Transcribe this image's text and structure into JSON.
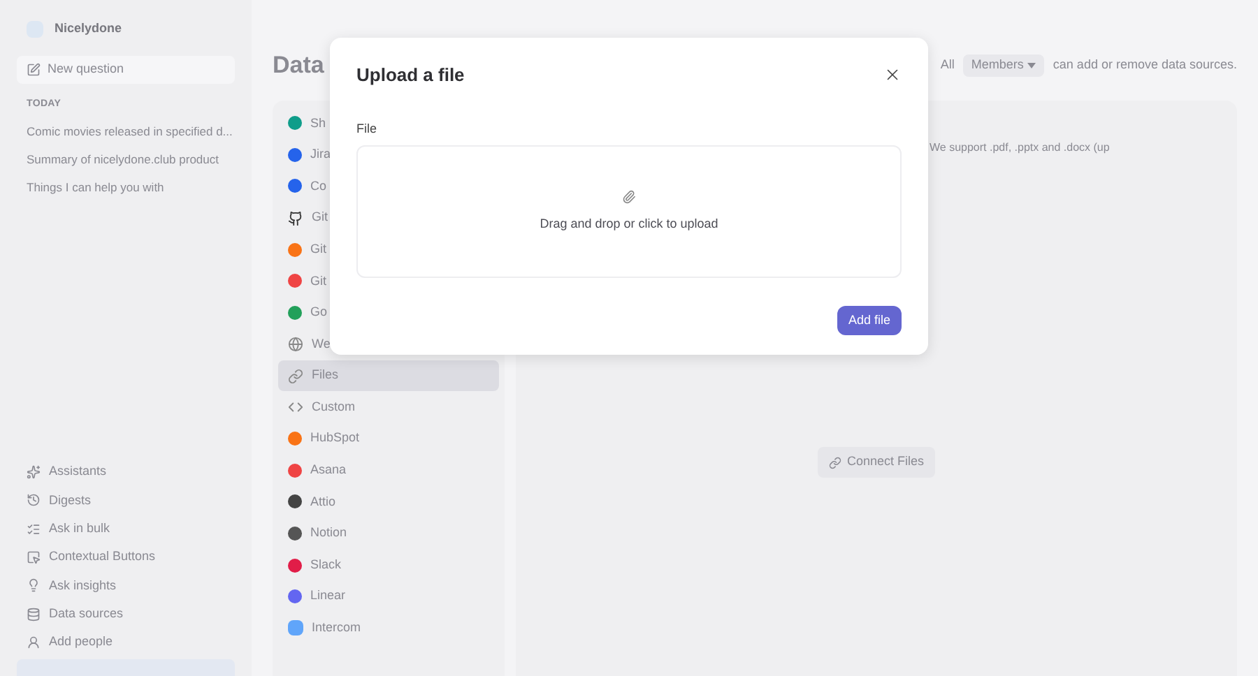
{
  "sidebar": {
    "workspace": "Nicelydone",
    "new_question": "New question",
    "section": "TODAY",
    "history": [
      "Comic movies released in specified d...",
      "Summary of nicelydone.club product",
      "Things I can help you with"
    ],
    "items": [
      "Assistants",
      "Digests",
      "Ask in bulk",
      "Contextual Buttons",
      "Ask insights",
      "Data sources",
      "Add people"
    ]
  },
  "page": {
    "title": "Data",
    "access": {
      "prefix": "All",
      "role": "Members",
      "suffix": "can add or remove data sources."
    },
    "sources": [
      {
        "label": "Sh",
        "selected": false
      },
      {
        "label": "Jira",
        "selected": false
      },
      {
        "label": "Co",
        "selected": false
      },
      {
        "label": "Git",
        "selected": false
      },
      {
        "label": "Git",
        "selected": false
      },
      {
        "label": "Git",
        "selected": false
      },
      {
        "label": "Go",
        "selected": false
      },
      {
        "label": "We",
        "selected": false
      },
      {
        "label": "Files",
        "selected": true
      },
      {
        "label": "Custom",
        "selected": false
      },
      {
        "label": "HubSpot",
        "selected": false
      },
      {
        "label": "Asana",
        "selected": false
      },
      {
        "label": "Attio",
        "selected": false
      },
      {
        "label": "Notion",
        "selected": false
      },
      {
        "label": "Slack",
        "selected": false
      },
      {
        "label": "Linear",
        "selected": false
      },
      {
        "label": "Intercom",
        "selected": false
      }
    ],
    "support_note": "We support .pdf, .pptx and .docx (up",
    "connect_button": "Connect Files"
  },
  "dialog": {
    "title": "Upload a file",
    "field_label": "File",
    "dropzone_text": "Drag and drop or click to upload",
    "submit": "Add file"
  }
}
